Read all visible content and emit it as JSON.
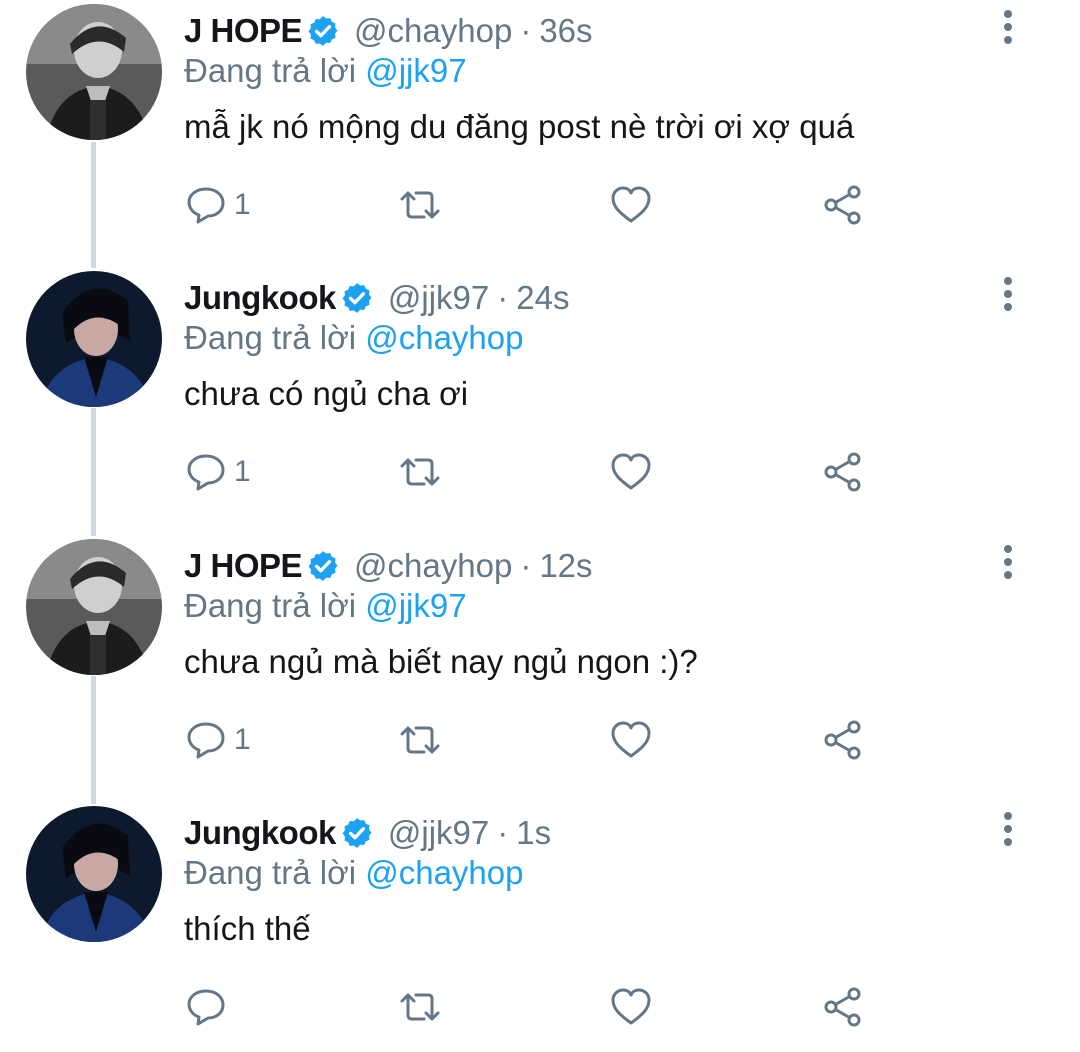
{
  "colors": {
    "text": "#14171a",
    "secondary": "#657786",
    "accent": "#1da1f2",
    "thread_line": "#cfd9de",
    "verified": "#1da1f2"
  },
  "tweets": [
    {
      "author_name": "J HOPE",
      "verified": true,
      "handle": "@chayhop",
      "separator": "·",
      "time": "36s",
      "replying_prefix": "Đang trả lời",
      "replying_to": "@jjk97",
      "text": "mẫ jk nó mộng du đăng post nè trời ơi xợ quá",
      "reply_count": "1",
      "avatar_icon": "avatar-jhope",
      "icons": [
        "reply-icon",
        "retweet-icon",
        "like-icon",
        "share-icon",
        "more-icon"
      ]
    },
    {
      "author_name": "Jungkook",
      "verified": true,
      "handle": "@jjk97",
      "separator": "·",
      "time": "24s",
      "replying_prefix": "Đang trả lời",
      "replying_to": "@chayhop",
      "text": "chưa có ngủ cha ơi",
      "reply_count": "1",
      "avatar_icon": "avatar-jungkook",
      "icons": [
        "reply-icon",
        "retweet-icon",
        "like-icon",
        "share-icon",
        "more-icon"
      ]
    },
    {
      "author_name": "J HOPE",
      "verified": true,
      "handle": "@chayhop",
      "separator": "·",
      "time": "12s",
      "replying_prefix": "Đang trả lời",
      "replying_to": "@jjk97",
      "text": "chưa ngủ mà biết nay ngủ ngon :)?",
      "reply_count": "1",
      "avatar_icon": "avatar-jhope",
      "icons": [
        "reply-icon",
        "retweet-icon",
        "like-icon",
        "share-icon",
        "more-icon"
      ]
    },
    {
      "author_name": "Jungkook",
      "verified": true,
      "handle": "@jjk97",
      "separator": "·",
      "time": "1s",
      "replying_prefix": "Đang trả lời",
      "replying_to": "@chayhop",
      "text": "thích thế",
      "reply_count": "",
      "avatar_icon": "avatar-jungkook",
      "icons": [
        "reply-icon",
        "retweet-icon",
        "like-icon",
        "share-icon",
        "more-icon"
      ]
    }
  ]
}
